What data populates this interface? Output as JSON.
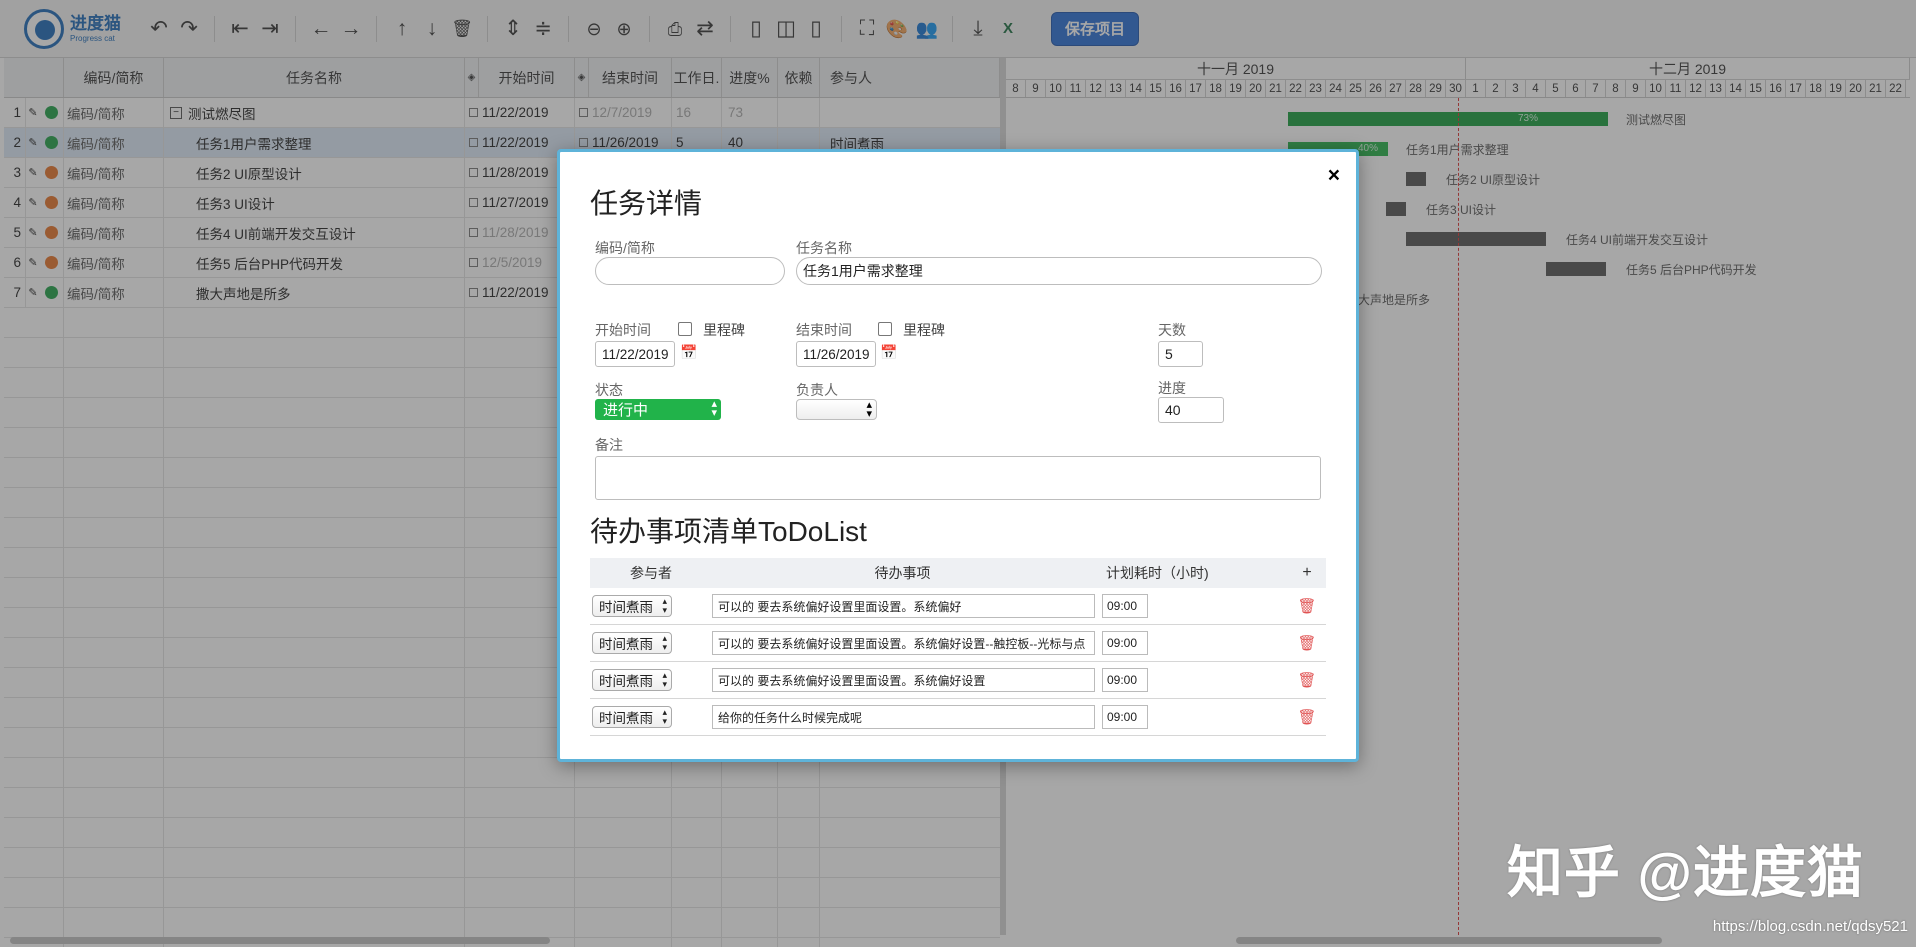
{
  "toolbar": {
    "logo_cn": "进度猫",
    "logo_en": "Progress cat",
    "save_label": "保存项目",
    "icons": [
      "undo-icon",
      "redo-icon",
      "outdent-icon",
      "indent-icon",
      "move-left-icon",
      "move-right-icon",
      "move-up-icon",
      "move-down-icon",
      "delete-icon",
      "expand-icon",
      "collapse-icon",
      "zoom-out-icon",
      "zoom-in-icon",
      "print-icon",
      "share-icon",
      "layout-left-icon",
      "layout-both-icon",
      "layout-right-icon",
      "fullscreen-icon",
      "palette-icon",
      "users-icon",
      "download-icon",
      "excel-icon"
    ]
  },
  "grid": {
    "headers": {
      "code": "编码/简称",
      "name": "任务名称",
      "start": "开始时间",
      "end": "结束时间",
      "days": "工作日.",
      "progress": "进度%",
      "depends": "依赖",
      "people": "参与人"
    },
    "rows": [
      {
        "num": "1",
        "status": "green",
        "code": "编码/简称",
        "name": "测试燃尽图",
        "start": "11/22/2019",
        "end": "12/7/2019",
        "days": "16",
        "progress": "73",
        "people": ""
      },
      {
        "num": "2",
        "status": "green",
        "code": "编码/简称",
        "name": "任务1用户需求整理",
        "start": "11/22/2019",
        "end": "11/26/2019",
        "days": "5",
        "progress": "40",
        "people": "时间煮雨"
      },
      {
        "num": "3",
        "status": "orange",
        "code": "编码/简称",
        "name": "任务2 UI原型设计",
        "start": "11/28/2019",
        "end": "",
        "days": "",
        "progress": "",
        "people": ""
      },
      {
        "num": "4",
        "status": "orange",
        "code": "编码/简称",
        "name": "任务3 UI设计",
        "start": "11/27/2019",
        "end": "",
        "days": "",
        "progress": "",
        "people": ""
      },
      {
        "num": "5",
        "status": "orange",
        "code": "编码/简称",
        "name": "任务4 UI前端开发交互设计",
        "start": "11/28/2019",
        "end": "",
        "days": "",
        "progress": "",
        "people": ""
      },
      {
        "num": "6",
        "status": "orange",
        "code": "编码/简称",
        "name": "任务5 后台PHP代码开发",
        "start": "12/5/2019",
        "end": "",
        "days": "",
        "progress": "",
        "people": ""
      },
      {
        "num": "7",
        "status": "green",
        "code": "编码/简称",
        "name": "撒大声地是所多",
        "start": "11/22/2019",
        "end": "",
        "days": "",
        "progress": "",
        "people": ""
      }
    ]
  },
  "gantt": {
    "months": [
      "十一月 2019",
      "十二月 2019"
    ],
    "days_nov": [
      "8",
      "9",
      "10",
      "11",
      "12",
      "13",
      "14",
      "15",
      "16",
      "17",
      "18",
      "19",
      "20",
      "21",
      "22",
      "23",
      "24",
      "25",
      "26",
      "27",
      "28",
      "29",
      "30"
    ],
    "days_dec": [
      "1",
      "2",
      "3",
      "4",
      "5",
      "6",
      "7",
      "8",
      "9",
      "10",
      "11",
      "12",
      "13",
      "14",
      "15",
      "16",
      "17",
      "18",
      "19",
      "20",
      "21",
      "22"
    ],
    "bars": [
      {
        "label": "测试燃尽图",
        "pct_label": "73%",
        "color": "#1a9e3f"
      },
      {
        "label": "任务1用户需求整理",
        "pct_label": "40%",
        "color": "#27b34a"
      },
      {
        "label": "任务2 UI原型设计",
        "pct_label": "",
        "color": "#555"
      },
      {
        "label": "任务3 UI设计",
        "pct_label": "",
        "color": "#555"
      },
      {
        "label": "任务4 UI前端开发交互设计",
        "pct_label": "",
        "color": "#555"
      },
      {
        "label": "任务5 后台PHP代码开发",
        "pct_label": "",
        "color": "#555"
      },
      {
        "label": "撒大声地是所多",
        "pct_label": "",
        "color": "#555"
      }
    ]
  },
  "modal": {
    "title": "任务详情",
    "close": "×",
    "code_label": "编码/简称",
    "code_value": "",
    "name_label": "任务名称",
    "name_value": "任务1用户需求整理",
    "start_label": "开始时间",
    "start_milestone": "里程碑",
    "start_value": "11/22/2019",
    "end_label": "结束时间",
    "end_milestone": "里程碑",
    "end_value": "11/26/2019",
    "days_label": "天数",
    "days_value": "5",
    "status_label": "状态",
    "status_value": "进行中",
    "owner_label": "负责人",
    "owner_value": "",
    "progress_label": "进度",
    "progress_value": "40",
    "notes_label": "备注",
    "todo_title": "待办事项清单ToDoList",
    "todo_headers": {
      "person": "参与者",
      "item": "待办事项",
      "hours": "计划耗时（小时)",
      "add": "+"
    },
    "todos": [
      {
        "person": "时间煮雨",
        "item": "可以的 要去系统偏好设置里面设置。系统偏好",
        "hours": "09:00"
      },
      {
        "person": "时间煮雨",
        "item": "可以的 要去系统偏好设置里面设置。系统偏好设置--触控板--光标与点",
        "hours": "09:00"
      },
      {
        "person": "时间煮雨",
        "item": "可以的 要去系统偏好设置里面设置。系统偏好设置",
        "hours": "09:00"
      },
      {
        "person": "时间煮雨",
        "item": "给你的任务什么时候完成呢",
        "hours": "09:00"
      }
    ]
  },
  "watermark": {
    "text": "知乎 @进度猫",
    "url": "https://blog.csdn.net/qdsy521"
  }
}
